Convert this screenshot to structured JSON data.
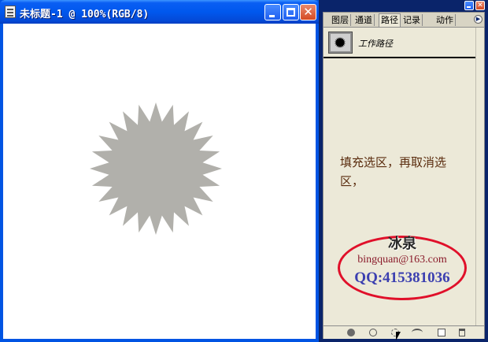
{
  "document_window": {
    "title": "未标题-1 @ 100%(RGB/8)",
    "shape_color": "#b1b0ab",
    "canvas_color": "#ffffff"
  },
  "panel": {
    "tabs": [
      {
        "label": "图层",
        "active": false
      },
      {
        "label": "通道",
        "active": false
      },
      {
        "label": "路径",
        "active": true
      },
      {
        "label": "记录",
        "active": false
      },
      {
        "label": "动作",
        "active": false
      }
    ],
    "menu_icon": "triangle-right-icon",
    "path_item": {
      "label": "工作路径"
    },
    "bottom_tools": [
      "fill-path-icon",
      "stroke-path-icon",
      "load-selection-icon",
      "make-work-path-icon",
      "new-path-icon",
      "delete-path-icon"
    ]
  },
  "instruction": {
    "text": "填充选区，再取消选区，"
  },
  "watermark": {
    "name": "冰泉",
    "email": "bingquan@163.com",
    "qq": "QQ:415381036",
    "ring_color": "#e0102a"
  }
}
